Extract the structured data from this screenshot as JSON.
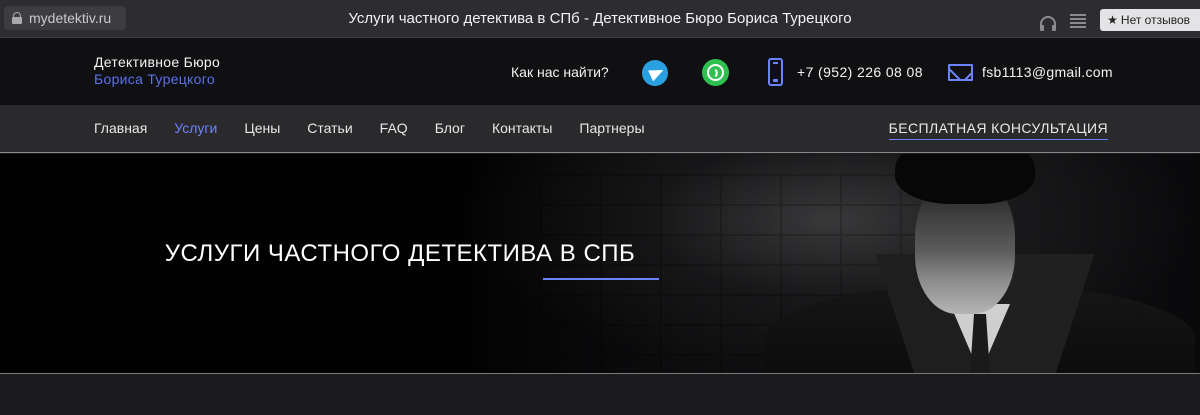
{
  "browser": {
    "url": "mydetektiv.ru",
    "title": "Услуги частного детектива в СПб - Детективное Бюро Бориса Турецкого",
    "reviews_label": "Нет отзывов",
    "reviews_star": "★"
  },
  "header": {
    "brand_line1": "Детективное Бюро",
    "brand_line2": "Бориса Турецкого",
    "find_label": "Как нас найти?",
    "phone": "+7 (952) 226 08 08",
    "email": "fsb1113@gmail.com"
  },
  "nav": {
    "items": [
      {
        "label": "Главная"
      },
      {
        "label": "Услуги"
      },
      {
        "label": "Цены"
      },
      {
        "label": "Статьи"
      },
      {
        "label": "FAQ"
      },
      {
        "label": "Блог"
      },
      {
        "label": "Контакты"
      },
      {
        "label": "Партнеры"
      }
    ],
    "active_index": 1,
    "cta": "БЕСПЛАТНАЯ КОНСУЛЬТАЦИЯ"
  },
  "hero": {
    "title": "УСЛУГИ ЧАСТНОГО ДЕТЕКТИВА В СПБ"
  },
  "colors": {
    "accent": "#6c83ff",
    "brand_blue": "#5a72e6",
    "telegram": "#2ba0e0",
    "whatsapp": "#2fc150"
  },
  "icons": [
    "lock-icon",
    "headphones-icon",
    "reader-icon",
    "star-icon",
    "telegram-icon",
    "whatsapp-icon",
    "phone-icon",
    "mail-icon"
  ]
}
